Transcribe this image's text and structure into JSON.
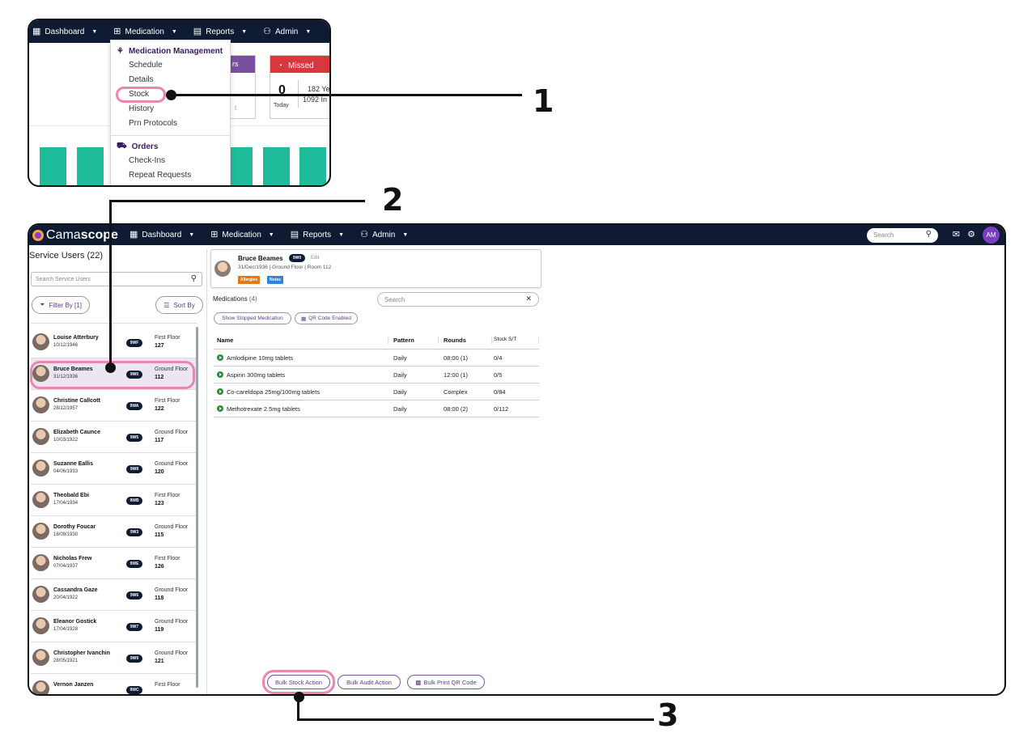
{
  "panel1": {
    "nav": [
      {
        "label": "Dashboard",
        "icon": "dashboard-icon"
      },
      {
        "label": "Medication",
        "icon": "medication-icon"
      },
      {
        "label": "Reports",
        "icon": "reports-icon"
      },
      {
        "label": "Admin",
        "icon": "admin-icon"
      }
    ],
    "card_purple_title": "rs",
    "card_purple_link": "t",
    "missed": {
      "title": "Missed",
      "count": "0",
      "count_label": "Today",
      "line1": "182 Ye",
      "line2": "1092 In"
    },
    "dropdown": {
      "group1": "Medication Management",
      "group1_items": [
        "Schedule",
        "Details",
        "Stock",
        "History",
        "Prn Protocols"
      ],
      "group2": "Orders",
      "group2_items": [
        "Check-Ins",
        "Repeat Requests"
      ]
    },
    "chart_bars": [
      {
        "color": "#1ebc9b"
      }
    ]
  },
  "panel2": {
    "logo_pre": "Cama",
    "logo_bold": "scope",
    "nav": [
      {
        "label": "Dashboard"
      },
      {
        "label": "Medication"
      },
      {
        "label": "Reports"
      },
      {
        "label": "Admin"
      }
    ],
    "top_search_placeholder": "Search",
    "user_initials": "AM",
    "service_users_title": "Service Users (22)",
    "search_users_placeholder": "Search Service Users",
    "filter_label": "Filter By [1]",
    "sort_label": "Sort By",
    "users": [
      {
        "name": "Louise Atterbury",
        "dob": "10/12/1946",
        "badge": "9WF",
        "floor": "First Floor",
        "room": "127"
      },
      {
        "name": "Bruce Beames",
        "dob": "31/12/1936",
        "badge": "9W0",
        "floor": "Ground Floor",
        "room": "112"
      },
      {
        "name": "Christine Callcott",
        "dob": "28/12/1957",
        "badge": "9WA",
        "floor": "First Floor",
        "room": "122"
      },
      {
        "name": "Elizabeth Caunce",
        "dob": "10/03/1922",
        "badge": "9W5",
        "floor": "Ground Floor",
        "room": "117"
      },
      {
        "name": "Suzanne Eallis",
        "dob": "04/06/1933",
        "badge": "9W8",
        "floor": "Ground Floor",
        "room": "120"
      },
      {
        "name": "Theobald Ebi",
        "dob": "17/04/1934",
        "badge": "9WB",
        "floor": "First Floor",
        "room": "123"
      },
      {
        "name": "Dorothy Foucar",
        "dob": "16/09/1930",
        "badge": "9W3",
        "floor": "Ground Floor",
        "room": "115"
      },
      {
        "name": "Nicholas Frew",
        "dob": "07/04/1937",
        "badge": "9WE",
        "floor": "First Floor",
        "room": "126"
      },
      {
        "name": "Cassandra Gaze",
        "dob": "20/04/1922",
        "badge": "9W6",
        "floor": "Ground Floor",
        "room": "118"
      },
      {
        "name": "Eleanor Gostick",
        "dob": "17/04/1928",
        "badge": "9W7",
        "floor": "Ground Floor",
        "room": "119"
      },
      {
        "name": "Christopher Ivanchin",
        "dob": "28/05/1921",
        "badge": "9W9",
        "floor": "Ground Floor",
        "room": "121"
      },
      {
        "name": "Vernon Janzen",
        "dob": "",
        "badge": "9WC",
        "floor": "First Floor",
        "room": ""
      }
    ],
    "patient": {
      "name": "Bruce Beames",
      "badge": "9W0",
      "edit": "Edit",
      "info": "31/Dec/1936 | Ground Floor | Room 112",
      "tag_allergies": "Allergies",
      "tag_notes": "Notes"
    },
    "medications_title": "Medications",
    "medications_count": "(4)",
    "med_search_placeholder": "Search",
    "show_stopped_label": "Show Stopped Medication",
    "qr_enabled_label": "QR Code Enabled",
    "table_headers": {
      "name": "Name",
      "pattern": "Pattern",
      "rounds": "Rounds",
      "stock": "Stock S/T"
    },
    "medications": [
      {
        "name": "Amlodipine 10mg tablets",
        "pattern": "Daily",
        "rounds": "08:00 (1)",
        "stock": "0/4"
      },
      {
        "name": "Aspirin 300mg tablets",
        "pattern": "Daily",
        "rounds": "12:00 (1)",
        "stock": "0/5"
      },
      {
        "name": "Co-careldopa 25mg/100mg tablets",
        "pattern": "Daily",
        "rounds": "Complex",
        "stock": "0/84"
      },
      {
        "name": "Methotrexate 2.5mg tablets",
        "pattern": "Daily",
        "rounds": "08:00 (2)",
        "stock": "0/112"
      }
    ],
    "bulk_stock_label": "Bulk Stock Action",
    "bulk_audit_label": "Bulk Audit Action",
    "bulk_qr_label": "Bulk Print QR Code"
  },
  "callouts": {
    "one": "1",
    "two": "2",
    "three": "3"
  },
  "colors": {
    "nav_bg": "#0e1b33",
    "accent_purple": "#5a3c86",
    "highlight": "#ee85ae",
    "missed_red": "#d9363e",
    "bar_teal": "#1ebc9b"
  }
}
